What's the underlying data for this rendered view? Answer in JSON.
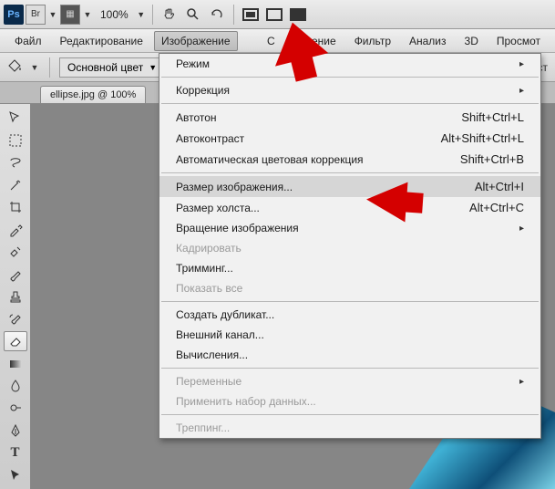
{
  "toolbar": {
    "zoom": "100%"
  },
  "menubar": {
    "file": "Файл",
    "edit": "Редактирование",
    "image": "Изображение",
    "layer_masked": "С",
    "select_masked": "деление",
    "filter": "Фильтр",
    "analysis": "Анализ",
    "three_d": "3D",
    "view_masked": "Просмот"
  },
  "optbar": {
    "swatch_label": "Основной цвет",
    "right_frag": "пуст"
  },
  "doc_tab": "ellipse.jpg @ 100%",
  "menu": {
    "mode": "Режим",
    "correction": "Коррекция",
    "autotone": "Автотон",
    "autotone_sc": "Shift+Ctrl+L",
    "autocontrast": "Автоконтраст",
    "autocontrast_sc": "Alt+Shift+Ctrl+L",
    "autocolor": "Автоматическая цветовая коррекция",
    "autocolor_sc": "Shift+Ctrl+B",
    "imgsize": "Размер изображения...",
    "imgsize_sc": "Alt+Ctrl+I",
    "canvassize": "Размер холста...",
    "canvassize_sc": "Alt+Ctrl+C",
    "rotate": "Вращение изображения",
    "crop": "Кадрировать",
    "trim": "Тримминг...",
    "reveal": "Показать все",
    "duplicate": "Создать дубликат...",
    "apply_ext": "Внешний канал...",
    "calc": "Вычисления...",
    "variables": "Переменные",
    "applydata": "Применить набор данных...",
    "trap": "Треппинг..."
  }
}
